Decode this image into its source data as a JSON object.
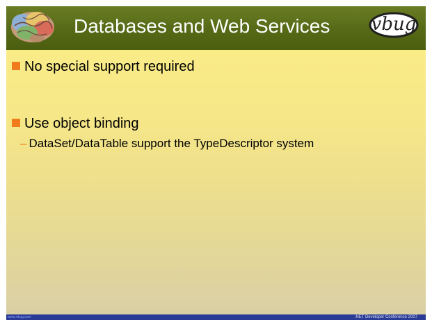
{
  "slide": {
    "title": "Databases and Web Services",
    "logo_text": "vbug",
    "bullets": [
      {
        "text": "No special support required"
      },
      {
        "text": "Use object binding"
      }
    ],
    "sub_bullet": {
      "dash": "–",
      "text": "DataSet/DataTable support the TypeDescriptor system"
    },
    "footer": {
      "left": "www.vbug.com",
      "right": ".NET Developer Conference 2007"
    }
  },
  "colors": {
    "title_bar": "#576a17",
    "bullet_accent": "#f07c1c",
    "footer_bar": "#2a3b95"
  }
}
